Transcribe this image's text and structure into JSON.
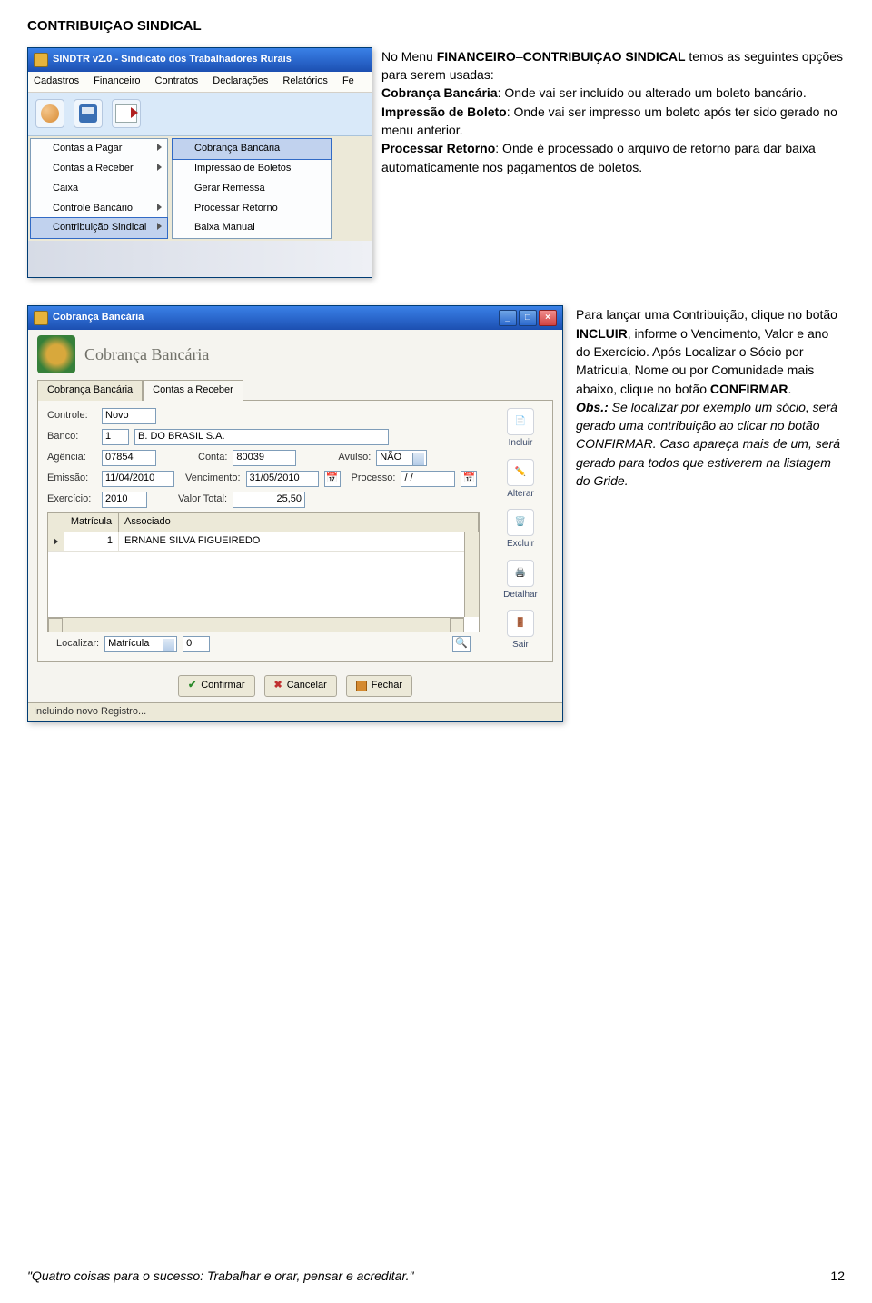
{
  "section_title": "CONTRIBUIÇAO SINDICAL",
  "app1": {
    "title": "SINDTR v2.0 - Sindicato dos Trabalhadores Rurais",
    "menubar": [
      "Cadastros",
      "Financeiro",
      "Contratos",
      "Declarações",
      "Relatórios",
      "Fe"
    ],
    "menu1": [
      {
        "label": "Contas a Pagar",
        "arrow": true
      },
      {
        "label": "Contas a Receber",
        "arrow": true
      },
      {
        "label": "Caixa",
        "arrow": false
      },
      {
        "label": "Controle Bancário",
        "arrow": true
      },
      {
        "label": "Contribuição Sindical",
        "arrow": true,
        "hl": true
      }
    ],
    "menu2": [
      {
        "label": "Cobrança Bancária",
        "hl": true
      },
      {
        "label": "Impressão de Boletos"
      },
      {
        "label": "Gerar Remessa"
      },
      {
        "label": "Processar Retorno"
      },
      {
        "label": "Baixa Manual"
      }
    ]
  },
  "txt1": {
    "l1a": "No Menu ",
    "l1b": "FINANCEIRO",
    "l1c": "–",
    "l1d": "CONTRIBUIÇAO SINDICAL",
    "l2": "temos as seguintes opções para serem usadas:",
    "l3a": "Cobrança Bancária",
    "l3b": ": Onde vai ser incluído ou alterado um boleto bancário.",
    "l4a": "Impressão de Boleto",
    "l4b": ": Onde vai ser impresso um boleto após ter sido gerado no menu anterior.",
    "l5a": "Processar Retorno",
    "l5b": ": Onde é processado o arquivo de retorno para dar baixa automaticamente nos pagamentos de boletos."
  },
  "app2": {
    "title": "Cobrança Bancária",
    "heading": "Cobrança Bancária",
    "tab_a": "Cobrança Bancária",
    "tab_b": "Contas a Receber",
    "labels": {
      "controle": "Controle:",
      "banco": "Banco:",
      "agencia": "Agência:",
      "conta": "Conta:",
      "avulso": "Avulso:",
      "emissao": "Emissão:",
      "vencimento": "Vencimento:",
      "processo": "Processo:",
      "exercicio": "Exercício:",
      "valortotal": "Valor Total:",
      "localizar": "Localizar:"
    },
    "values": {
      "controle": "Novo",
      "banco_code": "1",
      "banco_name": "B. DO BRASIL S.A.",
      "agencia": "07854",
      "conta": "80039",
      "avulso": "NÃO",
      "emissao": "11/04/2010",
      "vencimento": "31/05/2010",
      "processo": "/  /",
      "exercicio": "2010",
      "valortotal": "25,50",
      "loc_field": "Matrícula",
      "loc_val": "0"
    },
    "grid": {
      "col1": "Matrícula",
      "col2": "Associado",
      "r1_c1": "1",
      "r1_c2": "ERNANE SILVA FIGUEIREDO"
    },
    "sidebtns": [
      "Incluir",
      "Alterar",
      "Excluir",
      "Detalhar",
      "Sair"
    ],
    "btns": {
      "confirmar": "Confirmar",
      "cancelar": "Cancelar",
      "fechar": "Fechar"
    },
    "status": "Incluindo novo Registro..."
  },
  "txt2": {
    "p1a": "Para lançar uma Contribuição, clique no botão ",
    "p1b": "INCLUIR",
    "p1c": ", informe o Vencimento, Valor e ano do Exercício. Após Localizar o Sócio por Matricula, Nome ou por Comunidade mais abaixo, clique no botão ",
    "p1d": "CONFIRMAR",
    "p1e": ".",
    "p2a": "Obs.:",
    "p2b": " Se localizar  por exemplo um sócio, será gerado uma contribuição ao clicar no botão CONFIRMAR. Caso apareça mais de um, será gerado para todos que estiverem na listagem do Gride."
  },
  "footer": {
    "quote": "\"Quatro coisas para o sucesso: Trabalhar e orar, pensar e acreditar.\"",
    "page": "12"
  }
}
